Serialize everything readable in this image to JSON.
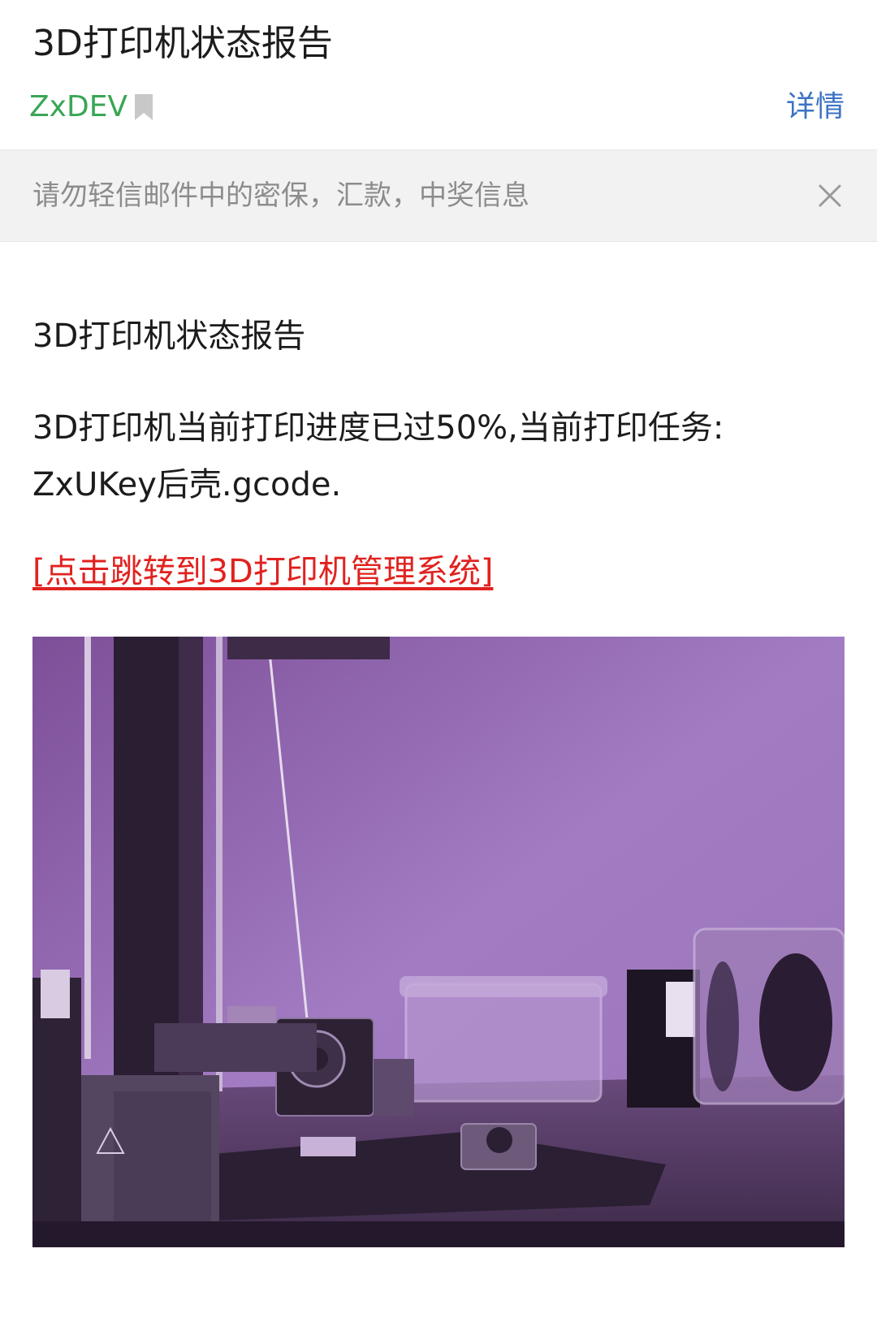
{
  "header": {
    "subject": "3D打印机状态报告",
    "sender": "ZxDEV",
    "details_label": "详情"
  },
  "warning": {
    "text": "请勿轻信邮件中的密保，汇款，中奖信息"
  },
  "body": {
    "title": "3D打印机状态报告",
    "paragraph_line1": "3D打印机当前打印进度已过50%,当前打印任务:",
    "paragraph_line2": "ZxUKey后壳.gcode.",
    "link_text": "[点击跳转到3D打印机管理系统]"
  },
  "colors": {
    "sender": "#3aa655",
    "details": "#3d73c4",
    "link": "#e0221f",
    "warning_bg": "#f2f2f2",
    "image_tint": "#8e62a8"
  }
}
